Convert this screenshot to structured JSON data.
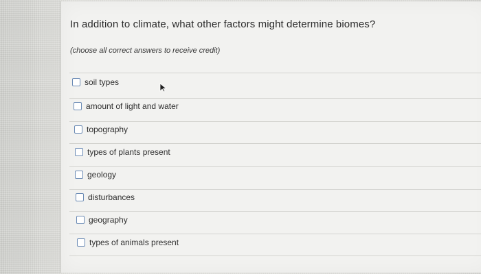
{
  "question": {
    "title": "In addition to climate, what other factors might determine biomes?",
    "note": "(choose all correct answers to receive credit)"
  },
  "answers": [
    {
      "label": "soil types",
      "checked": false
    },
    {
      "label": "amount of light and water",
      "checked": false
    },
    {
      "label": "topography",
      "checked": false
    },
    {
      "label": "types of plants present",
      "checked": false
    },
    {
      "label": "geology",
      "checked": false
    },
    {
      "label": "disturbances",
      "checked": false
    },
    {
      "label": "geography",
      "checked": false
    },
    {
      "label": "types of animals present",
      "checked": false
    }
  ],
  "icons": {
    "cursor": "mouse-pointer-icon",
    "checkbox": "checkbox-icon"
  },
  "colors": {
    "checkbox_border": "#6b8bb5",
    "panel_background": "#f2f2f0",
    "text": "#2a2a2a"
  }
}
